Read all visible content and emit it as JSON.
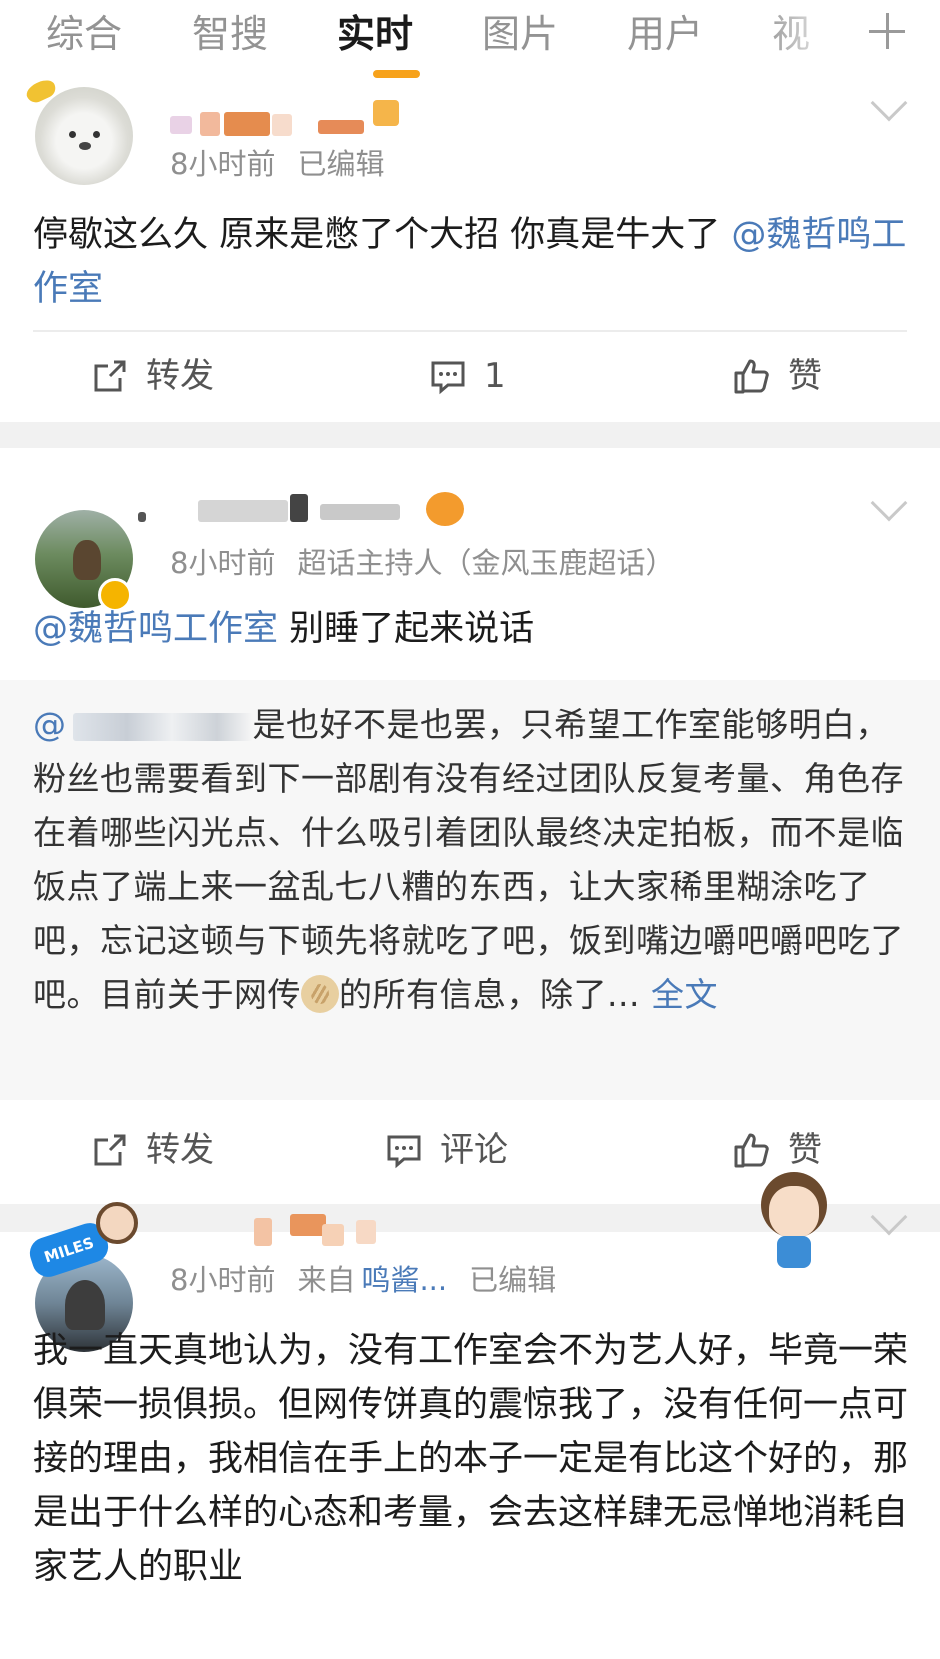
{
  "tabs": [
    {
      "label": "综合",
      "active": false
    },
    {
      "label": "智搜",
      "active": false
    },
    {
      "label": "实时",
      "active": true
    },
    {
      "label": "图片",
      "active": false
    },
    {
      "label": "用户",
      "active": false
    },
    {
      "label": "视",
      "active": false
    }
  ],
  "colors": {
    "accent": "#f7a21b",
    "mention": "#4a7ab8",
    "meta": "#8f8f8f"
  },
  "posts": [
    {
      "time": "8小时前",
      "edited": "已编辑",
      "text": "停歇这么久 原来是憋了个大招 你真是牛大了 ",
      "mention": "@魏哲鸣工作室",
      "actions": {
        "repost": "转发",
        "comment": "1",
        "like": "赞"
      },
      "icons": {
        "repost": "share-icon",
        "comment": "comment-icon",
        "like": "thumbs-up-icon"
      }
    },
    {
      "time": "8小时前",
      "role": "超话主持人（金风玉鹿超话）",
      "mention": "@魏哲鸣工作室",
      "text": " 别睡了起来说话",
      "repost_prefix": "@",
      "repost_text_1": "是也好不是也罢，只希望工作室能够明白，粉丝也需要看到下一部剧有没有经过团队反复考量、角色存在着哪些闪光点、什么吸引着团队最终决定拍板，而不是临饭点了端上来一盆乱七八糟的东西，让大家稀里糊涂吃了吧，忘记这顿与下顿先将就吃了吧，饭到嘴边嚼吧嚼吧吃了吧。目前关于网传",
      "repost_text_2": "的所有信息，除了...",
      "full_text_link": "全文",
      "actions": {
        "repost": "转发",
        "comment": "评论",
        "like": "赞"
      }
    },
    {
      "time": "8小时前",
      "source_prefix": "来自",
      "source": "鸣酱...",
      "edited": "已编辑",
      "avatar_badge": "MILES",
      "text": "我一直天真地认为，没有工作室会不为艺人好，毕竟一荣俱荣一损俱损。但网传饼真的震惊我了，没有任何一点可接的理由，我相信在手上的本子一定是有比这个好的，那是出于什么样的心态和考量，会去这样肆无忌惮地消耗自家艺人的职业"
    }
  ]
}
